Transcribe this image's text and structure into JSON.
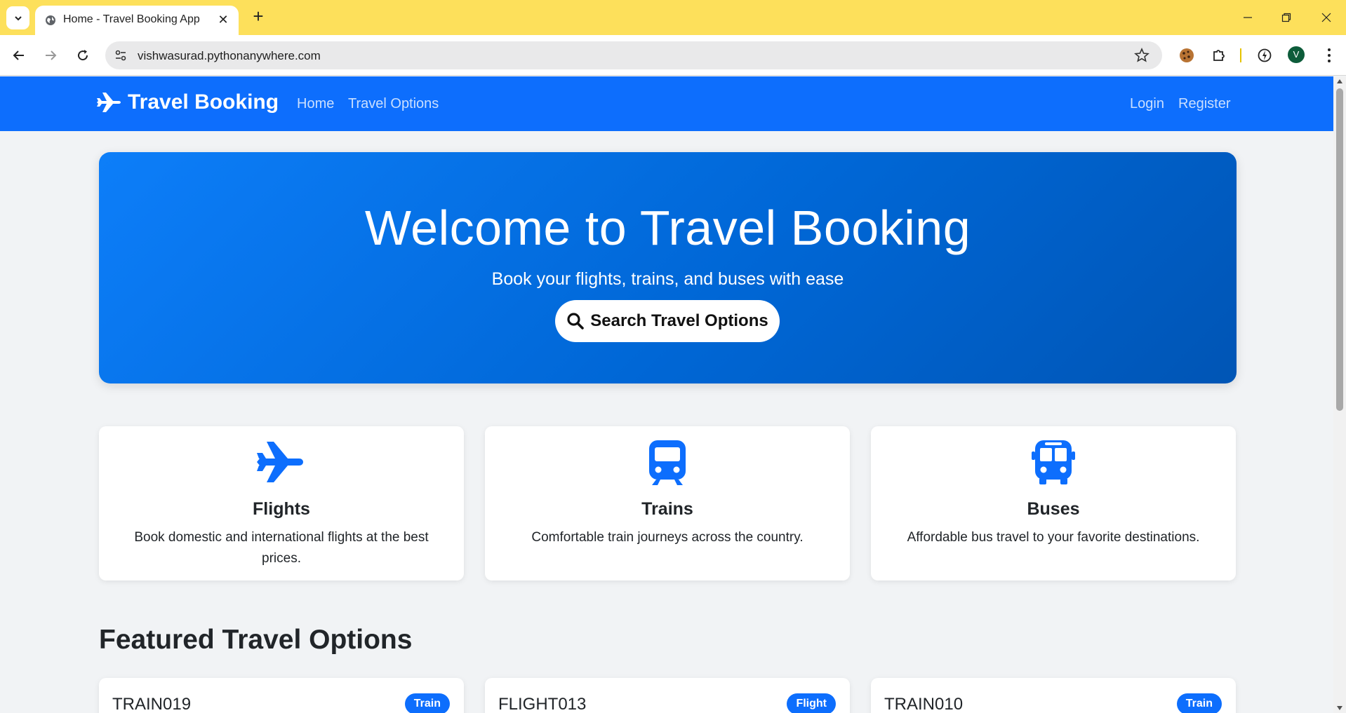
{
  "browser": {
    "tab_title": "Home - Travel Booking App",
    "url": "vishwasurad.pythonanywhere.com",
    "avatar_letter": "V"
  },
  "navbar": {
    "brand": "Travel Booking",
    "links": [
      "Home",
      "Travel Options"
    ],
    "auth": [
      "Login",
      "Register"
    ]
  },
  "hero": {
    "title": "Welcome to Travel Booking",
    "subtitle": "Book your flights, trains, and buses with ease",
    "button": "Search Travel Options"
  },
  "features": [
    {
      "icon": "plane-icon",
      "title": "Flights",
      "text": "Book domestic and international flights at the best prices."
    },
    {
      "icon": "train-icon",
      "title": "Trains",
      "text": "Comfortable train journeys across the country."
    },
    {
      "icon": "bus-icon",
      "title": "Buses",
      "text": "Affordable bus travel to your favorite destinations."
    }
  ],
  "featured": {
    "title": "Featured Travel Options",
    "items": [
      {
        "code": "TRAIN019",
        "type": "Train"
      },
      {
        "code": "FLIGHT013",
        "type": "Flight"
      },
      {
        "code": "TRAIN010",
        "type": "Train"
      }
    ]
  },
  "colors": {
    "primary": "#0d6efd",
    "chrome": "#fde05b"
  }
}
